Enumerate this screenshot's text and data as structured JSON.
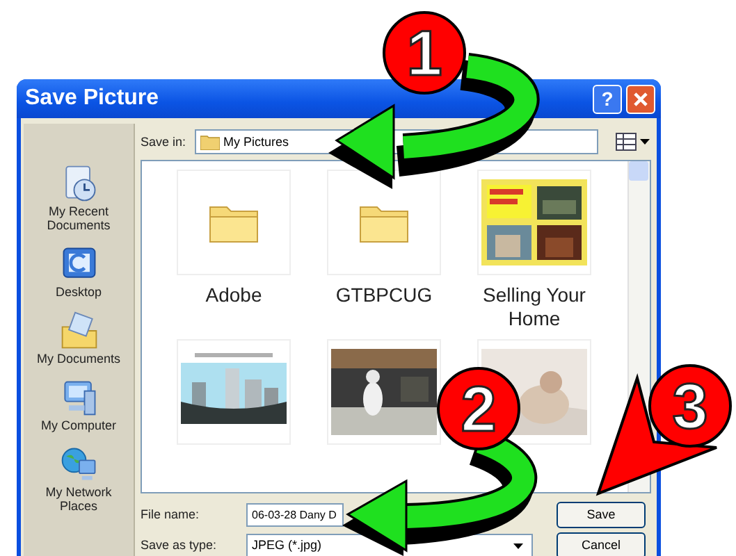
{
  "window": {
    "title": "Save Picture",
    "help": "?"
  },
  "save_in": {
    "label": "Save in:",
    "value": "My Pictures"
  },
  "places": [
    {
      "label": "My Recent Documents",
      "kind": "recent"
    },
    {
      "label": "Desktop",
      "kind": "desktop"
    },
    {
      "label": "My Documents",
      "kind": "documents"
    },
    {
      "label": "My Computer",
      "kind": "computer"
    },
    {
      "label": "My Network Places",
      "kind": "network"
    }
  ],
  "files": [
    {
      "name": "Adobe",
      "kind": "folder"
    },
    {
      "name": "GTBPCUG",
      "kind": "folder"
    },
    {
      "name": "Selling Your Home",
      "kind": "picture"
    },
    {
      "kind": "picture"
    },
    {
      "kind": "picture"
    },
    {
      "kind": "picture"
    }
  ],
  "file_name": {
    "label": "File name:",
    "value": "06-03-28 Dany D"
  },
  "save_as_type": {
    "label": "Save as type:",
    "value": "JPEG (*.jpg)"
  },
  "buttons": [
    "Save",
    "Cancel"
  ],
  "annotations": [
    {
      "number": "1"
    },
    {
      "number": "2"
    },
    {
      "number": "3"
    }
  ]
}
